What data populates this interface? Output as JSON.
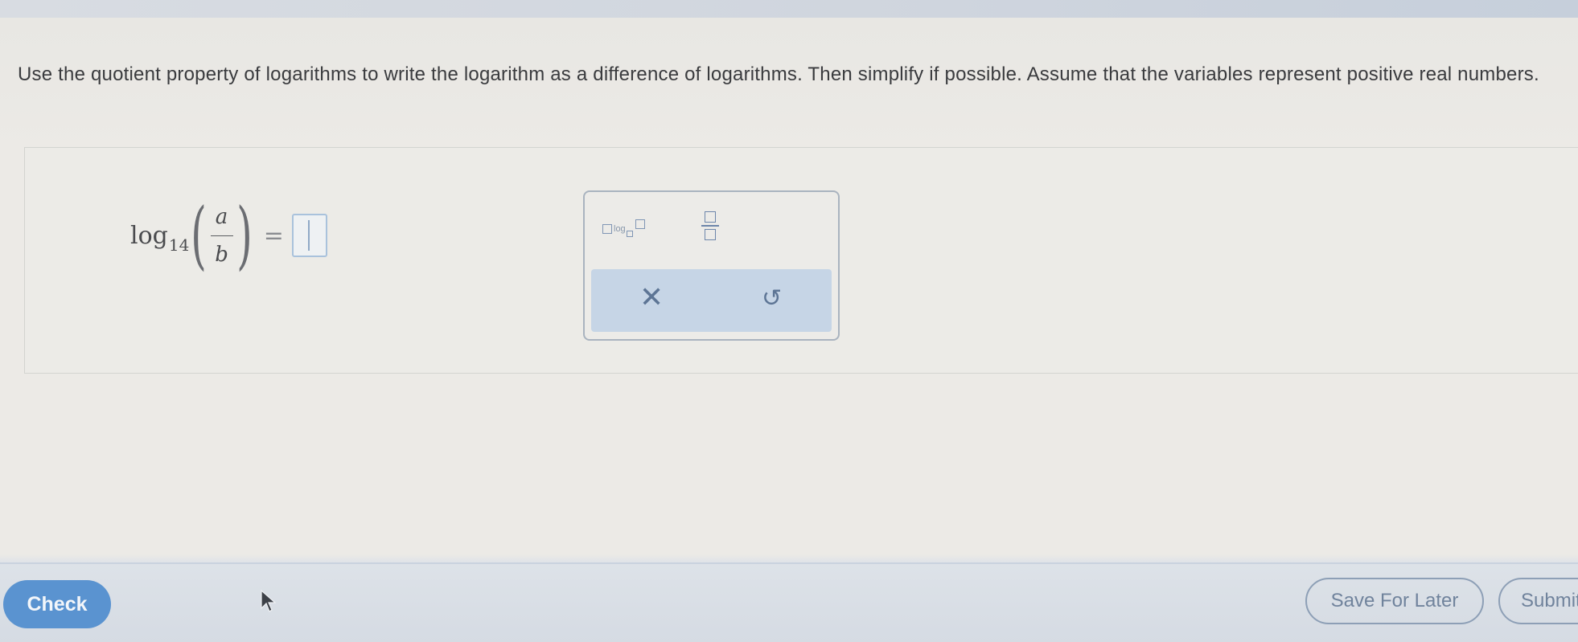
{
  "question": {
    "text": "Use the quotient property of logarithms to write the logarithm as a difference of logarithms. Then simplify if possible. Assume that the variables represent positive real numbers."
  },
  "expression": {
    "log_word": "log",
    "base": "14",
    "left_paren": "(",
    "numerator": "a",
    "denominator": "b",
    "right_paren": ")",
    "equals": "=",
    "answer_value": ""
  },
  "palette": {
    "log_template_label": "log",
    "fraction_template_icon": "fraction-template-icon",
    "clear_symbol": "✕",
    "undo_symbol": "↺"
  },
  "footer": {
    "check_label": "Check",
    "save_label": "Save For Later",
    "submit_label": "Submit"
  },
  "colors": {
    "accent": "#5a93d0",
    "palette_bg": "#c6d5e6",
    "outline_button": "#8d9fb6"
  }
}
